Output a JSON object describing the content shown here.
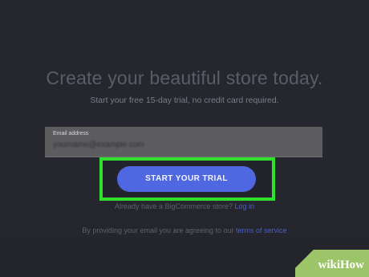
{
  "hero": {
    "headline": "Create your beautiful store today.",
    "subline": "Start your free 15-day trial, no credit card required."
  },
  "email_field": {
    "label": "Email address",
    "value": "yourname@example.com"
  },
  "cta": {
    "label": "START YOUR TRIAL"
  },
  "login_prompt": {
    "text": "Already have a BigCommerce store?",
    "link": "Log in"
  },
  "terms": {
    "text": "By providing your email you are agreeing to our",
    "link": "terms of service"
  },
  "watermark": {
    "wiki": "wiki",
    "how": "How"
  },
  "colors": {
    "background": "#26262f",
    "button": "#4f67e0",
    "highlight": "#30e12c",
    "link": "#4b5fc9"
  }
}
